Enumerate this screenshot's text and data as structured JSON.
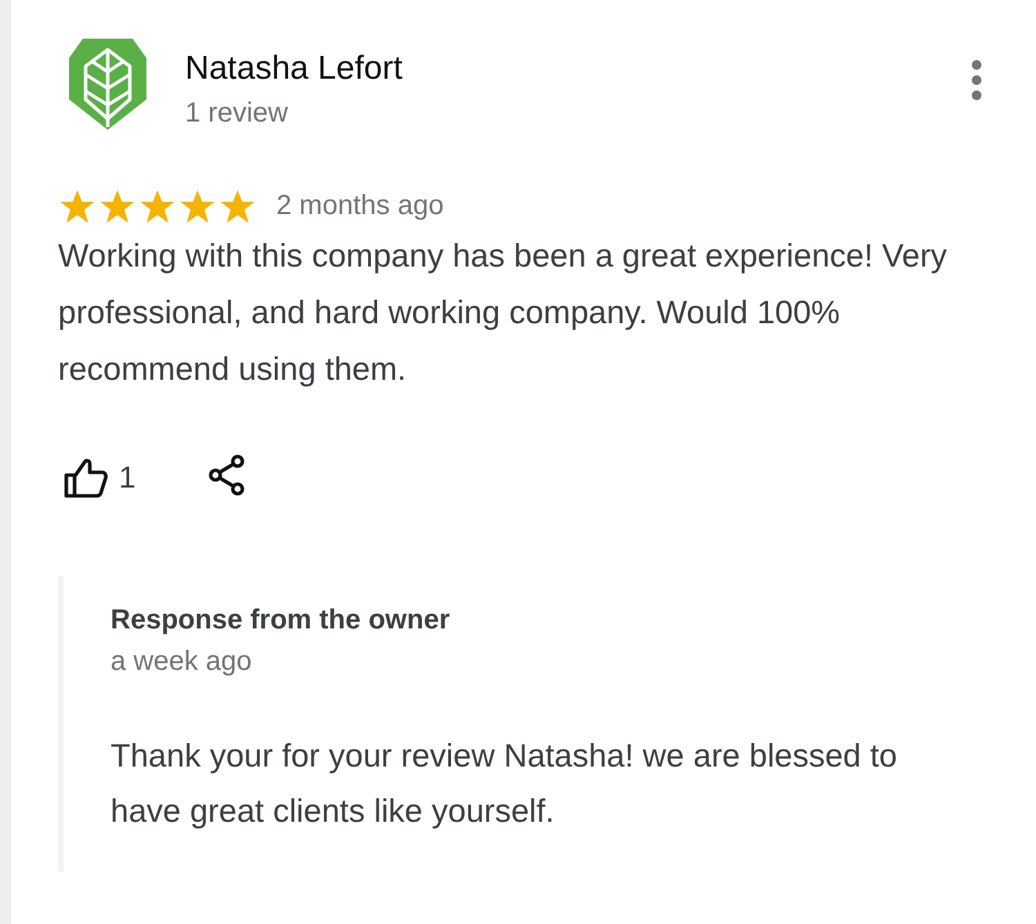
{
  "review": {
    "author": "Natasha Lefort",
    "author_meta": "1 review",
    "stars": 5,
    "time": "2 months ago",
    "text": "Working with this company has been a great experience! Very professional, and hard working company. Would 100% recommend using them.",
    "likes": "1"
  },
  "owner_response": {
    "heading": "Response from the owner",
    "time": "a week ago",
    "text": "Thank your for your review Natasha! we are blessed to have great clients like yourself."
  }
}
